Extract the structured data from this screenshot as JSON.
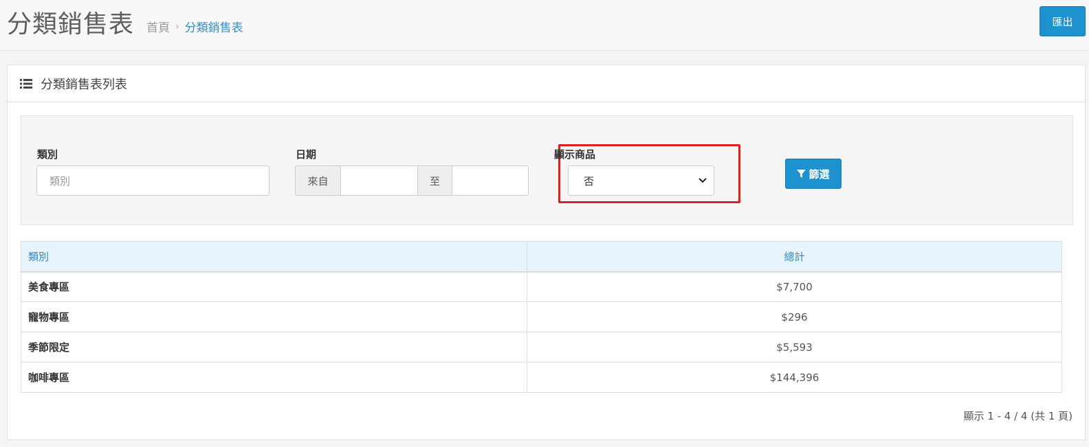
{
  "header": {
    "title": "分類銷售表",
    "breadcrumb": {
      "home": "首頁",
      "separator": "›",
      "current": "分類銷售表"
    },
    "export_label": "匯出"
  },
  "panel": {
    "title": "分類銷售表列表",
    "icon": "list-icon"
  },
  "filters": {
    "category": {
      "label": "類別",
      "placeholder": "類別",
      "value": ""
    },
    "date": {
      "label": "日期",
      "from_label": "來自",
      "to_label": "至",
      "from_value": "",
      "to_value": ""
    },
    "show_products": {
      "label": "顯示商品",
      "selected": "否"
    },
    "filter_button": "篩選"
  },
  "table": {
    "headers": {
      "category": "類別",
      "total": "總計"
    },
    "rows": [
      {
        "category": "美食專區",
        "total": "$7,700"
      },
      {
        "category": "寵物專區",
        "total": "$296"
      },
      {
        "category": "季節限定",
        "total": "$5,593"
      },
      {
        "category": "咖啡專區",
        "total": "$144,396"
      }
    ]
  },
  "pagination": {
    "info": "顯示 1 - 4 / 4 (共 1 頁)"
  },
  "colors": {
    "primary": "#1e91cf",
    "highlight": "#e0201c",
    "table_header_bg": "#e8f4fc",
    "link": "#3a8fc1"
  }
}
